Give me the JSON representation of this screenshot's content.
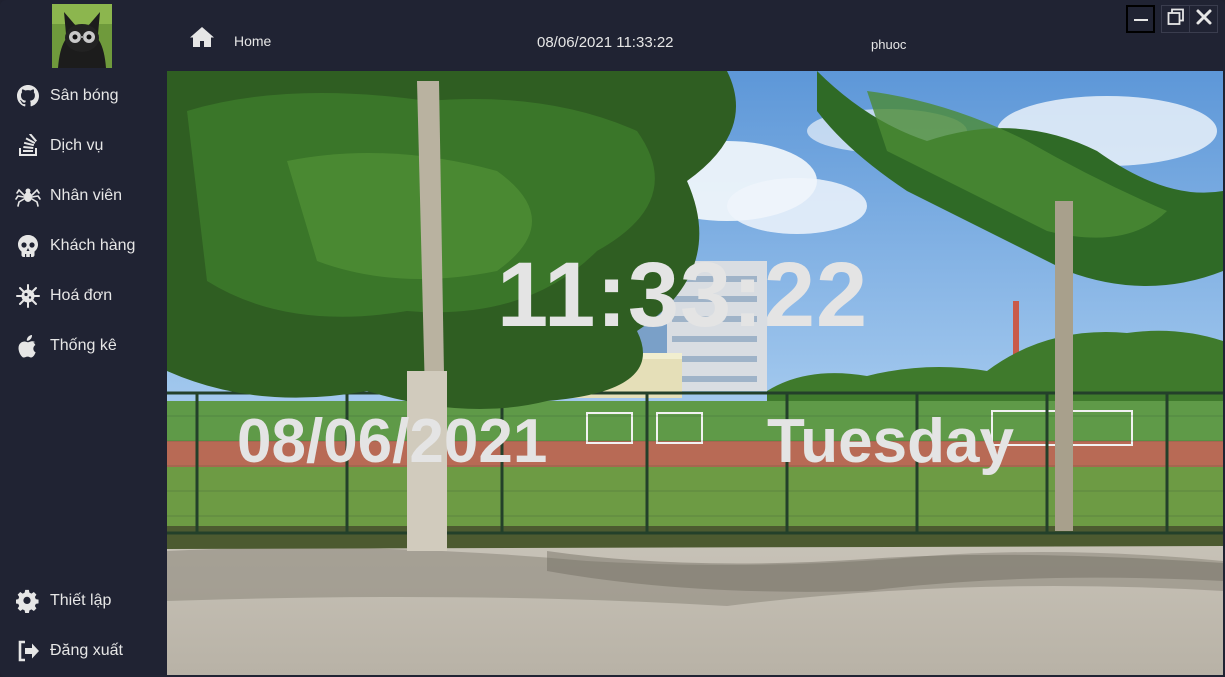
{
  "sidebar": {
    "items": [
      {
        "label": "Sân bóng",
        "icon": "github-icon"
      },
      {
        "label": "Dịch vụ",
        "icon": "stack-icon"
      },
      {
        "label": "Nhân viên",
        "icon": "spider-icon"
      },
      {
        "label": "Khách hàng",
        "icon": "skull-icon"
      },
      {
        "label": "Hoá đơn",
        "icon": "virus-icon"
      },
      {
        "label": "Thống kê",
        "icon": "apple-icon"
      }
    ],
    "bottom_items": [
      {
        "label": "Thiết lập",
        "icon": "gear-icon"
      },
      {
        "label": "Đăng xuất",
        "icon": "logout-icon"
      }
    ]
  },
  "topbar": {
    "home_label": "Home",
    "datetime": "08/06/2021 11:33:22",
    "username": "phuoc"
  },
  "main": {
    "time": "11:33:22",
    "date": "08/06/2021",
    "day": "Tuesday"
  },
  "colors": {
    "background": "#202333",
    "text": "#e6e6e6",
    "clock_text": "#e4e4e4"
  }
}
